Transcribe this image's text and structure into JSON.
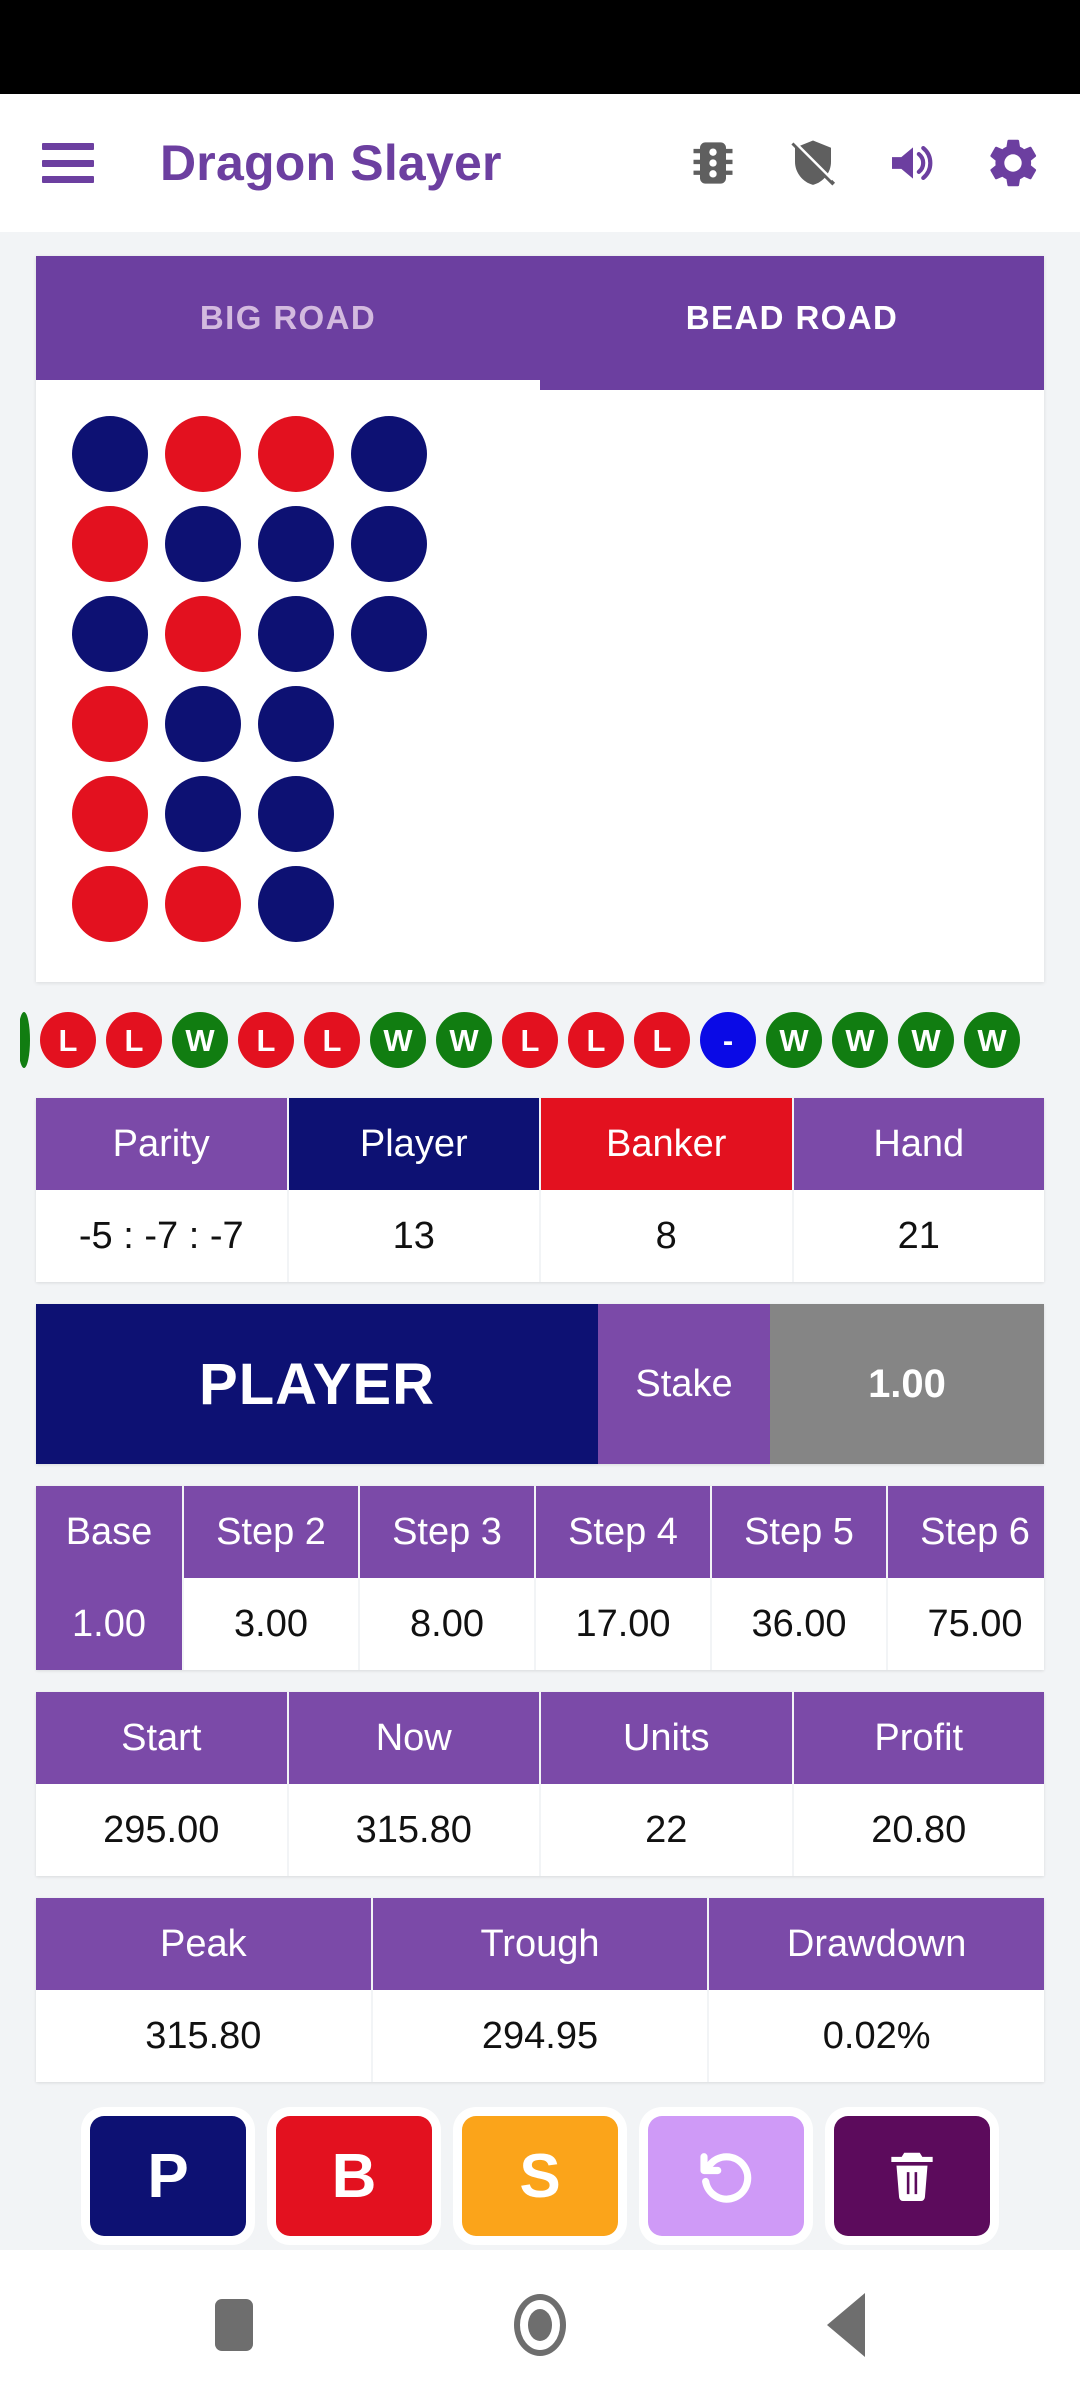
{
  "app": {
    "title": "Dragon Slayer",
    "menu_icon": "hamburger-menu-icon",
    "actions": [
      {
        "name": "traffic-light-icon",
        "state": "inactive"
      },
      {
        "name": "shield-off-icon",
        "state": "inactive"
      },
      {
        "name": "volume-up-icon",
        "state": "active"
      },
      {
        "name": "gear-icon",
        "state": "active"
      }
    ]
  },
  "colors": {
    "purple": "#6c3fa0",
    "purple_header": "#7b4aa8",
    "purple_light": "#d3badf",
    "navy": "#0d1173",
    "red": "#e3111f",
    "green": "#117d11",
    "blue": "#0a0ae6",
    "orange": "#fba41a",
    "grey": "#858585",
    "dark_purple": "#5c0b5c",
    "lilac": "#cf9af7"
  },
  "tabs": [
    {
      "label": "BIG ROAD",
      "active": false
    },
    {
      "label": "BEAD ROAD",
      "active": true
    }
  ],
  "bead_road": {
    "rows": [
      [
        "navy",
        "red",
        "red",
        "navy"
      ],
      [
        "red",
        "navy",
        "navy",
        "navy"
      ],
      [
        "navy",
        "red",
        "navy",
        "navy"
      ],
      [
        "red",
        "navy",
        "navy"
      ],
      [
        "red",
        "navy",
        "navy"
      ],
      [
        "red",
        "red",
        "navy"
      ]
    ]
  },
  "results": [
    {
      "label": "",
      "color": "green",
      "clipped": true
    },
    {
      "label": "L",
      "color": "red"
    },
    {
      "label": "L",
      "color": "red"
    },
    {
      "label": "W",
      "color": "green"
    },
    {
      "label": "L",
      "color": "red"
    },
    {
      "label": "L",
      "color": "red"
    },
    {
      "label": "W",
      "color": "green"
    },
    {
      "label": "W",
      "color": "green"
    },
    {
      "label": "L",
      "color": "red"
    },
    {
      "label": "L",
      "color": "red"
    },
    {
      "label": "L",
      "color": "red"
    },
    {
      "label": "-",
      "color": "blue"
    },
    {
      "label": "W",
      "color": "green"
    },
    {
      "label": "W",
      "color": "green"
    },
    {
      "label": "W",
      "color": "green"
    },
    {
      "label": "W",
      "color": "green"
    }
  ],
  "parity_table": {
    "headers": [
      "Parity",
      "Player",
      "Banker",
      "Hand"
    ],
    "values": [
      "-5 : -7 : -7",
      "13",
      "8",
      "21"
    ]
  },
  "bet_bar": {
    "side": "PLAYER",
    "stake_label": "Stake",
    "stake_value": "1.00"
  },
  "steps_table": {
    "headers": [
      "Base",
      "Step 2",
      "Step 3",
      "Step 4",
      "Step 5",
      "Step 6"
    ],
    "values": [
      "1.00",
      "3.00",
      "8.00",
      "17.00",
      "36.00",
      "75.00"
    ]
  },
  "balance_table": {
    "headers": [
      "Start",
      "Now",
      "Units",
      "Profit"
    ],
    "values": [
      "295.00",
      "315.80",
      "22",
      "20.80"
    ]
  },
  "risk_table": {
    "headers": [
      "Peak",
      "Trough",
      "Drawdown"
    ],
    "values": [
      "315.80",
      "294.95",
      "0.02%"
    ]
  },
  "action_buttons": [
    {
      "label": "P",
      "icon": "",
      "name": "player-bet-button",
      "bg": "#0d1173"
    },
    {
      "label": "B",
      "icon": "",
      "name": "banker-bet-button",
      "bg": "#e3111f"
    },
    {
      "label": "S",
      "icon": "",
      "name": "skip-button",
      "bg": "#fba41a"
    },
    {
      "label": "",
      "icon": "undo-icon",
      "name": "undo-button",
      "bg": "#cf9af7"
    },
    {
      "label": "",
      "icon": "trash-icon",
      "name": "clear-button",
      "bg": "#5c0b5c"
    }
  ],
  "nav_bar": [
    {
      "name": "recents-button",
      "icon": "square-icon"
    },
    {
      "name": "home-button",
      "icon": "circle-icon"
    },
    {
      "name": "back-button",
      "icon": "triangle-left-icon"
    }
  ]
}
